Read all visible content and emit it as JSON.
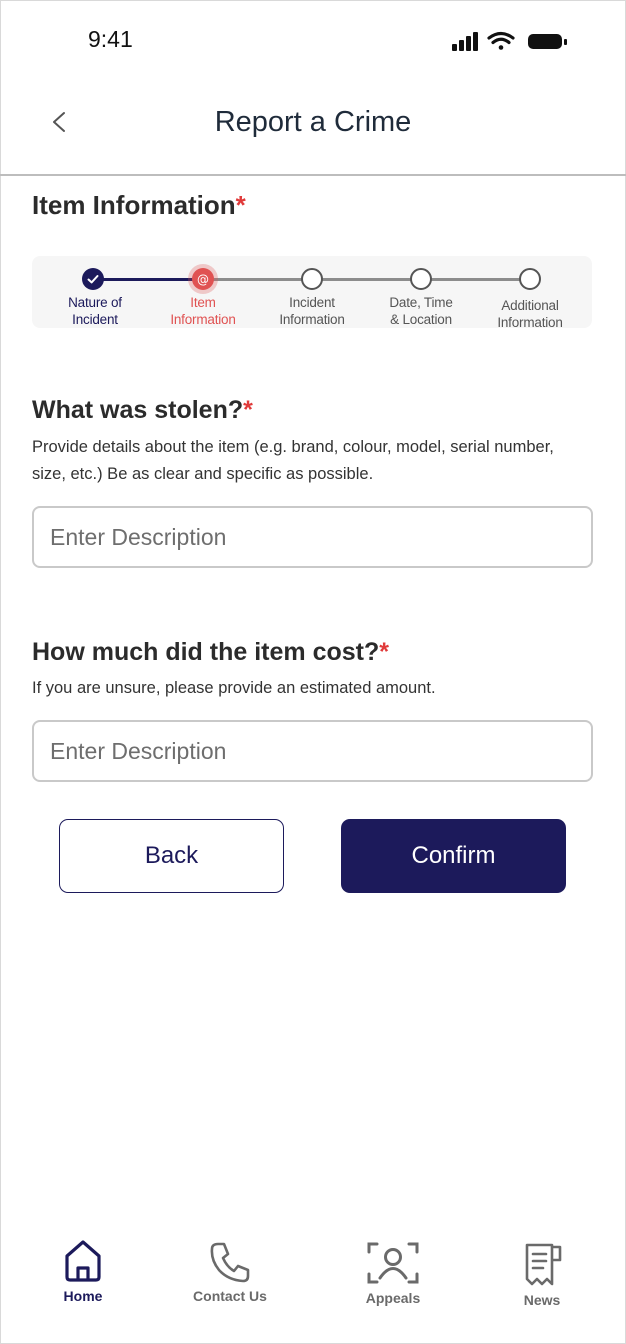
{
  "status_bar": {
    "time": "9:41",
    "icons": [
      "signal-icon",
      "wifi-icon",
      "battery-icon"
    ]
  },
  "header": {
    "title": "Report a Crime",
    "back_icon": "chevron-left-icon"
  },
  "section": {
    "title": "Item Information",
    "required_mark": "*"
  },
  "stepper": {
    "steps": [
      {
        "line1": "Nature of",
        "line2": "Incident",
        "state": "completed"
      },
      {
        "line1": "Item",
        "line2": "Information",
        "state": "current"
      },
      {
        "line1": "Incident",
        "line2": "Information",
        "state": "pending"
      },
      {
        "line1": "Date, Time",
        "line2": "& Location",
        "state": "pending"
      },
      {
        "line1": "Additional",
        "line2": "Information",
        "state": "pending"
      }
    ]
  },
  "question1": {
    "title": "What was stolen?",
    "required_mark": "*",
    "description": "Provide details about the item (e.g. brand, colour, model, serial number, size, etc.) Be as clear and specific as possible.",
    "placeholder": "Enter Description",
    "value": ""
  },
  "question2": {
    "title": "How much did the item cost?",
    "required_mark": "*",
    "description": "If you are unsure, please provide an estimated amount.",
    "placeholder": "Enter Description",
    "value": ""
  },
  "buttons": {
    "back": "Back",
    "confirm": "Confirm"
  },
  "tabbar": {
    "items": [
      {
        "label": "Home",
        "icon": "home-icon",
        "active": true
      },
      {
        "label": "Contact Us",
        "icon": "phone-icon",
        "active": false
      },
      {
        "label": "Appeals",
        "icon": "person-scan-icon",
        "active": false
      },
      {
        "label": "News",
        "icon": "news-icon",
        "active": false
      }
    ]
  },
  "colors": {
    "primary": "#1c1a5b",
    "required": "#e03a3a",
    "current_step": "#e05252",
    "pending_line": "#8c8c8c"
  }
}
